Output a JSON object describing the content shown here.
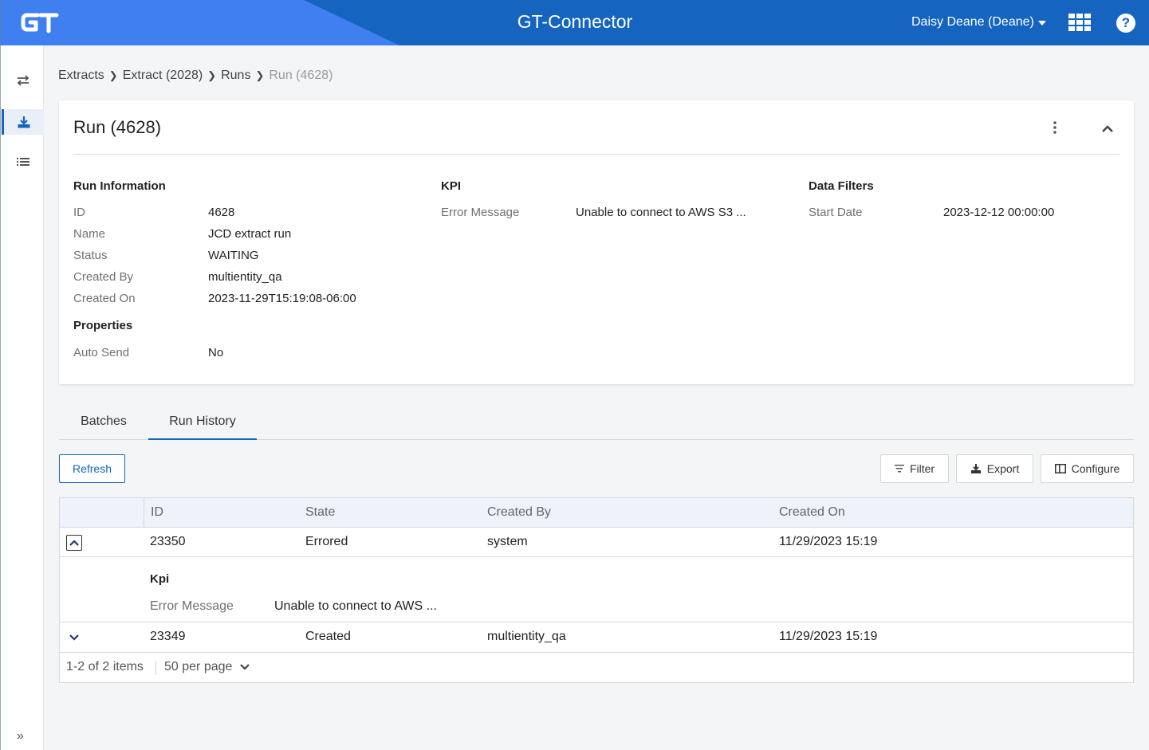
{
  "app": {
    "title": "GT-Connector",
    "logo_text": "GT",
    "user": "Daisy Deane (Deane)",
    "brand_colors": {
      "header": "#1565c0",
      "accent": "#3f7ff0"
    }
  },
  "sidebar": {
    "items": [
      {
        "name": "transfers",
        "icon": "swap-arrows-icon"
      },
      {
        "name": "extracts",
        "icon": "download-icon",
        "active": true
      },
      {
        "name": "list",
        "icon": "list-icon"
      }
    ],
    "expand_label": "»"
  },
  "breadcrumb": {
    "items": [
      "Extracts",
      "Extract (2028)",
      "Runs",
      "Run (4628)"
    ]
  },
  "run": {
    "title": "Run (4628)",
    "run_information": {
      "heading": "Run Information",
      "fields": [
        {
          "label": "ID",
          "value": "4628"
        },
        {
          "label": "Name",
          "value": "JCD extract run"
        },
        {
          "label": "Status",
          "value": "WAITING"
        },
        {
          "label": "Created By",
          "value": "multientity_qa"
        },
        {
          "label": "Created On",
          "value": "2023-11-29T15:19:08-06:00"
        }
      ]
    },
    "properties": {
      "heading": "Properties",
      "fields": [
        {
          "label": "Auto Send",
          "value": "No"
        }
      ]
    },
    "kpi": {
      "heading": "KPI",
      "fields": [
        {
          "label": "Error Message",
          "value": "Unable to connect to AWS S3 ..."
        }
      ]
    },
    "data_filters": {
      "heading": "Data Filters",
      "fields": [
        {
          "label": "Start Date",
          "value": "2023-12-12 00:00:00"
        }
      ]
    }
  },
  "tabs": [
    {
      "label": "Batches",
      "active": false
    },
    {
      "label": "Run History",
      "active": true
    }
  ],
  "toolbar": {
    "refresh": "Refresh",
    "filter": "Filter",
    "export": "Export",
    "configure": "Configure"
  },
  "grid": {
    "columns": [
      "ID",
      "State",
      "Created By",
      "Created On"
    ],
    "rows": [
      {
        "id": "23350",
        "state": "Errored",
        "created_by": "system",
        "created_on": "11/29/2023 15:19",
        "expanded": true,
        "detail": {
          "heading": "Kpi",
          "label": "Error Message",
          "value": "Unable to connect to AWS ..."
        }
      },
      {
        "id": "23349",
        "state": "Created",
        "created_by": "multientity_qa",
        "created_on": "11/29/2023 15:19",
        "expanded": false
      }
    ],
    "pager": {
      "summary": "1-2 of 2 items",
      "page_size": "50 per page"
    }
  }
}
